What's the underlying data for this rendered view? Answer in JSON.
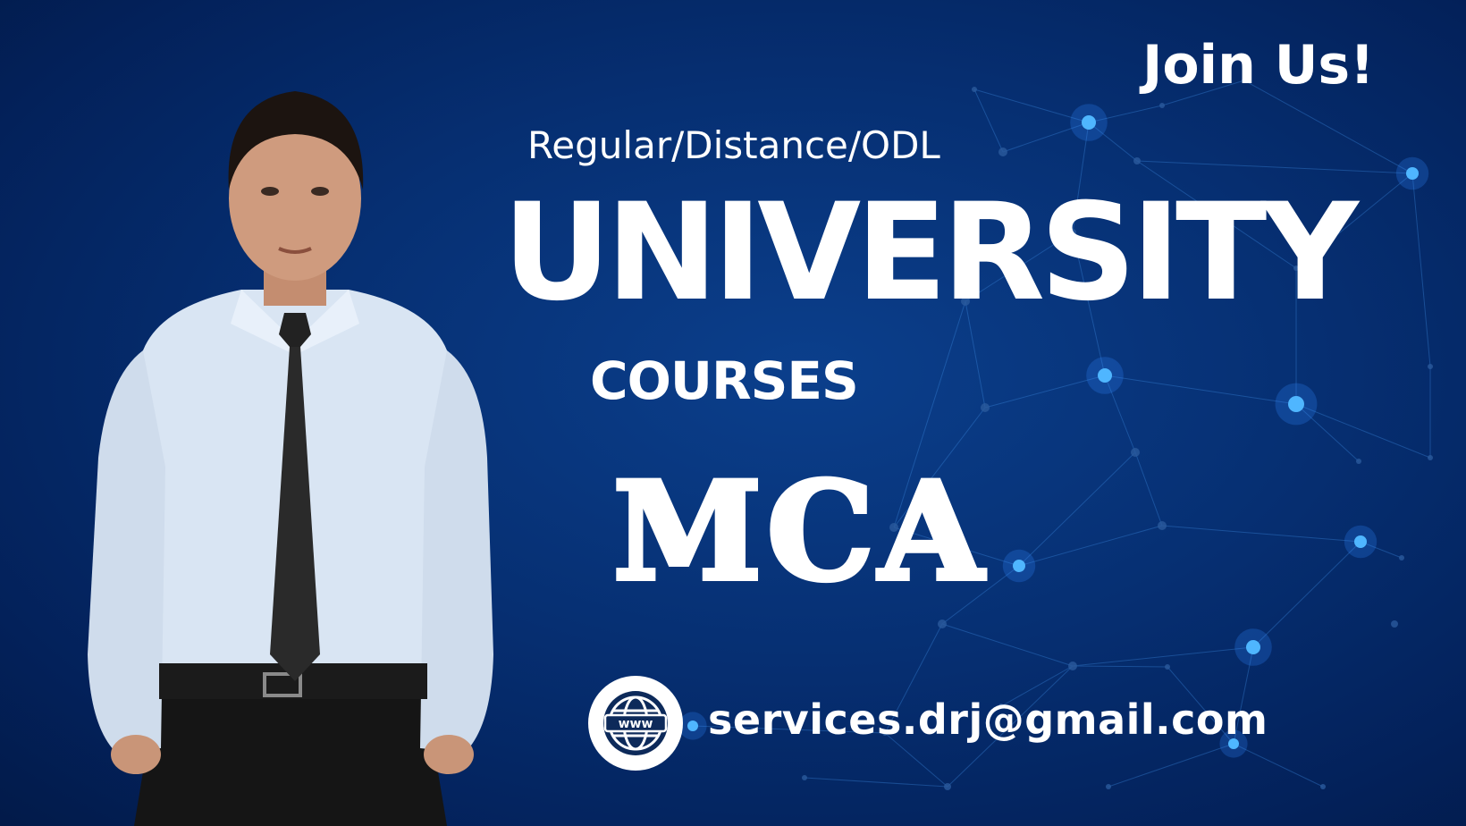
{
  "banner": {
    "join_label": "Join Us!",
    "study_modes": "Regular/Distance/ODL",
    "headline": "UNIVERSITY",
    "subheadline": "COURSES",
    "course": "MCA",
    "email": "services.drj@gmail.com"
  },
  "icons": {
    "contact": "globe-www-icon"
  },
  "colors": {
    "background": "#062f72",
    "text": "#ffffff",
    "network_glow": "#4fb6ff"
  }
}
